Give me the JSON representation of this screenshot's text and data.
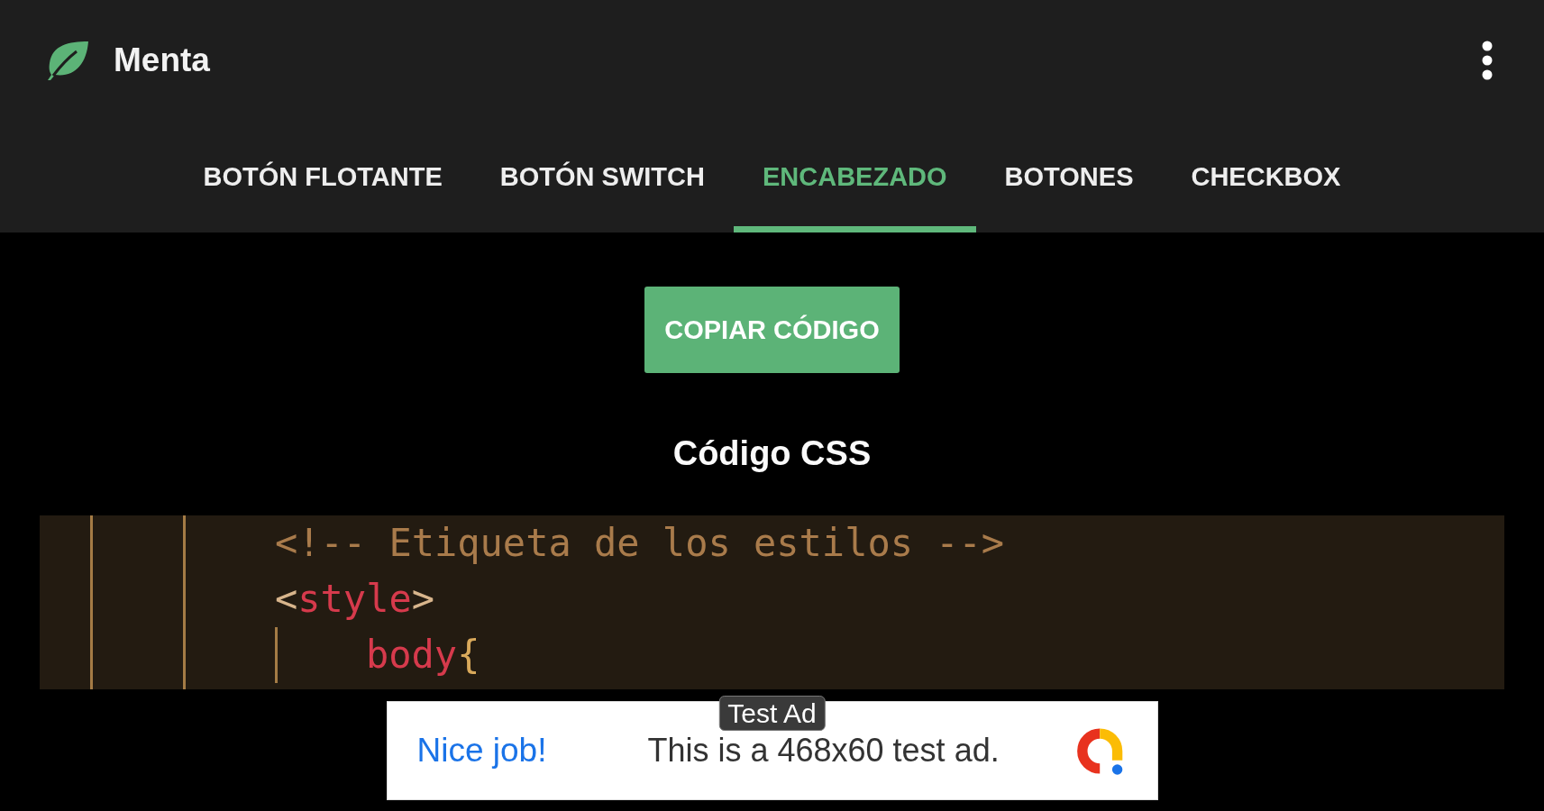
{
  "app_bar": {
    "title": "Menta"
  },
  "tabs": [
    {
      "label": "BOTÓN FLOTANTE",
      "selected": false
    },
    {
      "label": "BOTÓN SWITCH",
      "selected": false
    },
    {
      "label": "ENCABEZADO",
      "selected": true
    },
    {
      "label": "BOTONES",
      "selected": false
    },
    {
      "label": "CHECKBOX",
      "selected": false
    }
  ],
  "copy_button": {
    "label": "COPIAR CÓDIGO"
  },
  "section_title": "Código CSS",
  "code": {
    "lines": [
      {
        "tokens": [
          {
            "kind": "comment",
            "text": "<!-- Etiqueta de los estilos -->"
          }
        ]
      },
      {
        "tokens": [
          {
            "kind": "punct",
            "text": "<"
          },
          {
            "kind": "tag",
            "text": "style"
          },
          {
            "kind": "punct",
            "text": ">"
          }
        ],
        "children": [
          {
            "tokens": [
              {
                "kind": "tag",
                "text": "body"
              },
              {
                "kind": "brace",
                "text": "{"
              }
            ]
          }
        ]
      }
    ]
  },
  "ad": {
    "badge": "Test Ad",
    "headline": "Nice job!",
    "text": "This is a 468x60 test ad."
  }
}
